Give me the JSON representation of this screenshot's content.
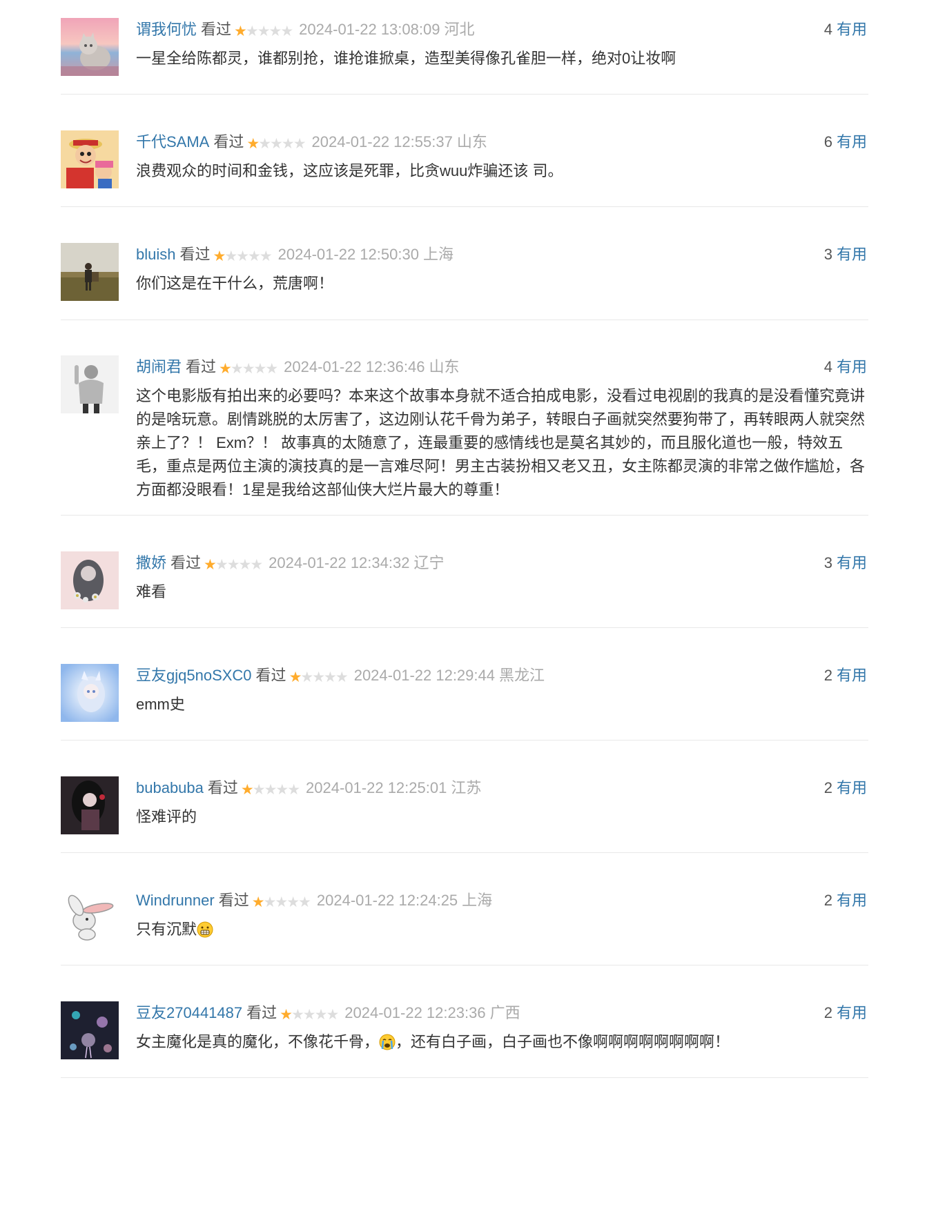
{
  "vote_label": "有用",
  "watched_label": "看过",
  "rating_max": 5,
  "colors": {
    "link": "#3377aa",
    "star_on": "#ffac2d",
    "star_off": "#dddddd",
    "meta": "#aaaaaa",
    "divider": "#e8e8e8"
  },
  "comments": [
    {
      "user": "谓我何忧",
      "status": "看过",
      "rating": 1,
      "time": "2024-01-22 13:08:09",
      "location": "河北",
      "votes": "4",
      "text": "一星全给陈都灵，谁都别抢，谁抢谁掀桌，造型美得像孔雀胆一样，绝对0让妆啊",
      "avatar_icon": "avatar-cat-on-pink-sky"
    },
    {
      "user": "千代SAMA",
      "status": "看过",
      "rating": 1,
      "time": "2024-01-22 12:55:37",
      "location": "山东",
      "votes": "6",
      "text": "浪费观众的时间和金钱，这应该是死罪，比贪wuu炸骗还该 司。",
      "avatar_icon": "avatar-anime-pirates"
    },
    {
      "user": "bluish",
      "status": "看过",
      "rating": 1,
      "time": "2024-01-22 12:50:30",
      "location": "上海",
      "votes": "3",
      "text": "你们这是在干什么，荒唐啊！",
      "avatar_icon": "avatar-person-on-grassland"
    },
    {
      "user": "胡闹君",
      "status": "看过",
      "rating": 1,
      "time": "2024-01-22 12:36:46",
      "location": "山东",
      "votes": "4",
      "text": "这个电影版有拍出来的必要吗？本来这个故事本身就不适合拍成电影，没看过电视剧的我真的是没看懂究竟讲的是啥玩意。剧情跳脱的太厉害了，这边刚认花千骨为弟子，转眼白子画就突然要狗带了，再转眼两人就突然亲上了？！ Exm？！ 故事真的太随意了，连最重要的感情线也是莫名其妙的，而且服化道也一般，特效五毛，重点是两位主演的演技真的是一言难尽阿！男主古装扮相又老又丑，女主陈都灵演的非常之做作尴尬，各方面都没眼看！1星是我给这部仙侠大烂片最大的尊重！",
      "avatar_icon": "avatar-hoodie-person-gray"
    },
    {
      "user": "撒娇",
      "status": "看过",
      "rating": 1,
      "time": "2024-01-22 12:34:32",
      "location": "辽宁",
      "votes": "3",
      "text": "难看",
      "avatar_icon": "avatar-girl-with-flowers"
    },
    {
      "user": "豆友gjq5noSXC0",
      "status": "看过",
      "rating": 1,
      "time": "2024-01-22 12:29:44",
      "location": "黑龙江",
      "votes": "2",
      "text": "emm史",
      "avatar_icon": "avatar-anime-girl-blue"
    },
    {
      "user": "bubabuba",
      "status": "看过",
      "rating": 1,
      "time": "2024-01-22 12:25:01",
      "location": "江苏",
      "votes": "2",
      "text": "怪难评的",
      "avatar_icon": "avatar-dark-haired-girl"
    },
    {
      "user": "Windrunner",
      "status": "看过",
      "rating": 1,
      "time": "2024-01-22 12:24:25",
      "location": "上海",
      "votes": "2",
      "text": "只有沉默",
      "emoji_after": "grimace-emoji",
      "avatar_icon": "avatar-cartoon-bunny"
    },
    {
      "user": "豆友270441487",
      "status": "看过",
      "rating": 1,
      "time": "2024-01-22 12:23:36",
      "location": "广西",
      "votes": "2",
      "text_before": "女主魔化是真的魔化，不像花千骨，",
      "text_emoji": "crying-emoji",
      "text_after": "，还有白子画，白子画也不像啊啊啊啊啊啊啊啊！",
      "avatar_icon": "avatar-jellyfish-night"
    }
  ]
}
